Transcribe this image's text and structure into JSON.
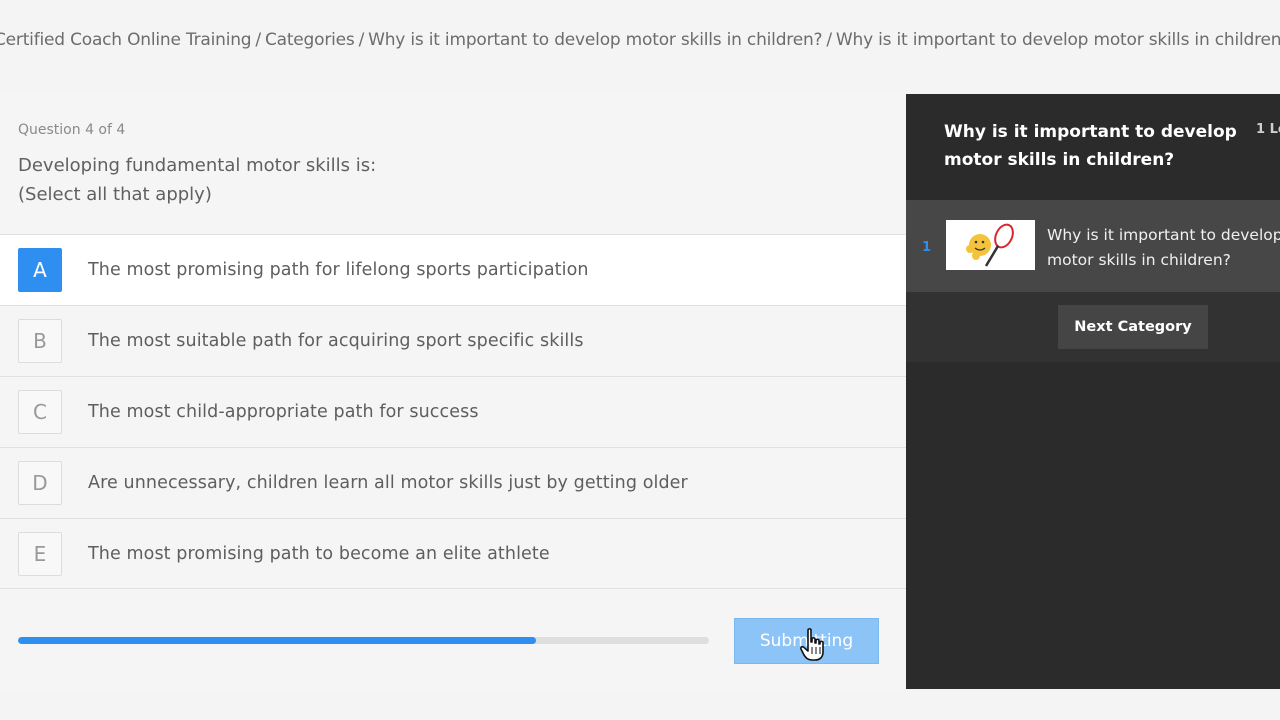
{
  "breadcrumb": {
    "items": [
      "Certified Coach Online Training",
      "Categories",
      "Why is it important to develop motor skills in children?",
      "Why is it important to develop motor skills in children?"
    ],
    "separator": "/"
  },
  "quiz": {
    "question_counter": "Question 4 of 4",
    "question_text": "Developing fundamental motor skills is:",
    "question_hint": "(Select all that apply)",
    "answers": [
      {
        "letter": "A",
        "label": "The most promising path for lifelong sports participation",
        "selected": true
      },
      {
        "letter": "B",
        "label": "The most suitable path for acquiring sport specific skills",
        "selected": false
      },
      {
        "letter": "C",
        "label": "The most child-appropriate path for success",
        "selected": false
      },
      {
        "letter": "D",
        "label": "Are unnecessary, children learn all motor skills just by getting older",
        "selected": false
      },
      {
        "letter": "E",
        "label": "The most promising path to become an elite athlete",
        "selected": false
      }
    ],
    "progress_fraction": 0.75,
    "submit_label": "Submitting"
  },
  "sidebar": {
    "title": "Why is it important to develop motor skills in children?",
    "lesson_count": "1 Le",
    "lessons": [
      {
        "number": "1",
        "title": "Why is it important to develop motor skills in children?"
      }
    ],
    "next_label": "Next Category"
  },
  "colors": {
    "accent": "#2f8ff0",
    "submit_disabled": "#8cc4f7",
    "sidebar_bg": "#2b2b2b",
    "sidebar_lesson_bg": "#474747"
  }
}
